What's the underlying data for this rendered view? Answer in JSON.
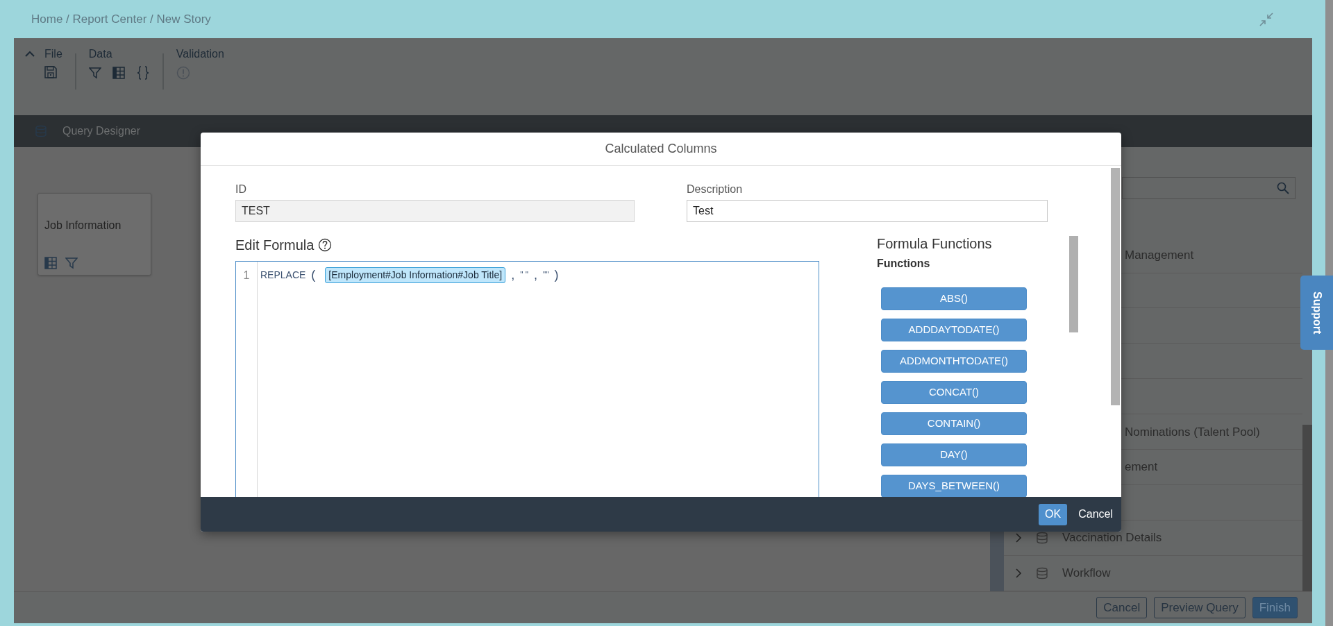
{
  "breadcrumb": "Home / Report Center / New Story",
  "toolbar": {
    "groups": [
      {
        "label": "File",
        "kind": "file"
      },
      {
        "label": "Data",
        "kind": "data"
      },
      {
        "label": "Validation",
        "kind": "validation"
      }
    ]
  },
  "designer_bar": {
    "title": "Query Designer"
  },
  "canvas": {
    "card": {
      "title": "Job Information"
    }
  },
  "side_panel": {
    "rows": [
      {
        "kind": "clipped",
        "label": "Management"
      },
      {
        "kind": "blank"
      },
      {
        "kind": "blank"
      },
      {
        "kind": "blank"
      },
      {
        "kind": "blank"
      },
      {
        "kind": "clipped",
        "label": "Nominations (Talent Pool)"
      },
      {
        "kind": "clipped",
        "label": "ement"
      },
      {
        "kind": "blank"
      },
      {
        "kind": "node",
        "label": "Vaccination Details"
      },
      {
        "kind": "node",
        "label": "Workflow"
      }
    ]
  },
  "support_tab": "Support",
  "footer_buttons": [
    {
      "label": "Cancel",
      "primary": false
    },
    {
      "label": "Preview Query",
      "primary": false
    },
    {
      "label": "Finish",
      "primary": true
    }
  ],
  "dialog": {
    "title": "Calculated Columns",
    "id_field": {
      "label": "ID",
      "value": "TEST",
      "readonly": true
    },
    "description_field": {
      "label": "Description",
      "value": "Test",
      "readonly": false
    },
    "editor": {
      "title": "Edit Formula",
      "lines": [
        {
          "number": "1",
          "tokens": [
            {
              "kind": "keyword",
              "text": "REPLACE"
            },
            {
              "kind": "punct",
              "text": "("
            },
            {
              "kind": "field",
              "text": "[Employment#Job Information#Job Title]"
            },
            {
              "kind": "punct",
              "text": ","
            },
            {
              "kind": "string",
              "text": "\" \""
            },
            {
              "kind": "punct",
              "text": ","
            },
            {
              "kind": "string",
              "text": "\"\""
            },
            {
              "kind": "punct",
              "text": ")"
            }
          ]
        }
      ]
    },
    "functions": {
      "title": "Formula Functions",
      "subtitle": "Functions",
      "items": [
        "ABS()",
        "ADDDAYTODATE()",
        "ADDMONTHTODATE()",
        "CONCAT()",
        "CONTAIN()",
        "DAY()",
        "DAYS_BETWEEN()"
      ]
    },
    "buttons": [
      {
        "label": "OK",
        "primary": true
      },
      {
        "label": "Cancel",
        "primary": false
      }
    ]
  }
}
